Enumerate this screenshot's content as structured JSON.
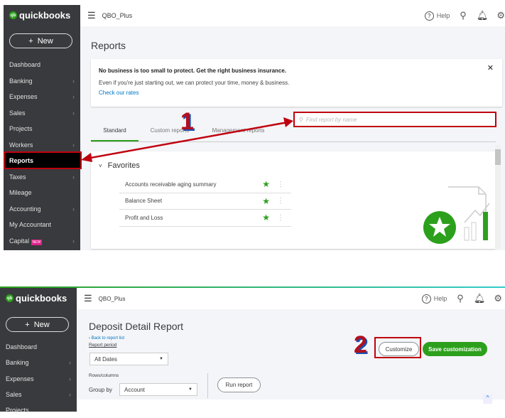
{
  "panel1": {
    "logo": "quickbooks",
    "logo_badge": "qb",
    "new_label": "New",
    "company": "QBO_Plus",
    "help": "Help",
    "nav": [
      {
        "label": "Dashboard",
        "chevron": false
      },
      {
        "label": "Banking",
        "chevron": true
      },
      {
        "label": "Expenses",
        "chevron": true
      },
      {
        "label": "Sales",
        "chevron": true
      },
      {
        "label": "Projects",
        "chevron": false
      },
      {
        "label": "Workers",
        "chevron": true
      },
      {
        "label": "Reports",
        "chevron": false,
        "active": true
      },
      {
        "label": "Taxes",
        "chevron": true
      },
      {
        "label": "Mileage",
        "chevron": false
      },
      {
        "label": "Accounting",
        "chevron": true
      },
      {
        "label": "My Accountant",
        "chevron": false
      },
      {
        "label": "Capital",
        "chevron": true,
        "badge": "NEW"
      }
    ],
    "page_title": "Reports",
    "banner": {
      "headline": "No business is too small to protect. Get the right business insurance.",
      "body": "Even if you're just starting out, we can protect your time, money & business.",
      "link": "Check our rates",
      "close": "✕"
    },
    "search_placeholder": "Find report by name",
    "tabs": [
      "Standard",
      "Custom reports",
      "Management reports"
    ],
    "favorites_title": "Favorites",
    "favorites": [
      "Accounts receivable aging summary",
      "Balance Sheet",
      "Profit and Loss"
    ],
    "annotation": "1"
  },
  "panel2": {
    "logo": "quickbooks",
    "logo_badge": "qb",
    "new_label": "New",
    "company": "QBO_Plus",
    "help": "Help",
    "nav": [
      {
        "label": "Dashboard",
        "chevron": false
      },
      {
        "label": "Banking",
        "chevron": true
      },
      {
        "label": "Expenses",
        "chevron": true
      },
      {
        "label": "Sales",
        "chevron": true
      },
      {
        "label": "Projects",
        "chevron": false
      }
    ],
    "page_title": "Deposit Detail Report",
    "back_link": "Back to report list",
    "report_period_label": "Report period",
    "report_period_value": "All Dates",
    "rows_columns_label": "Rows/columns",
    "group_by_label": "Group by",
    "group_by_value": "Account",
    "run_report": "Run report",
    "customize": "Customize",
    "save_customization": "Save customization",
    "annotation": "2"
  },
  "colors": {
    "brand": "#2ca01c",
    "annotation": "#c0000f",
    "sidebar": "#393a3d",
    "link": "#0077c5"
  }
}
